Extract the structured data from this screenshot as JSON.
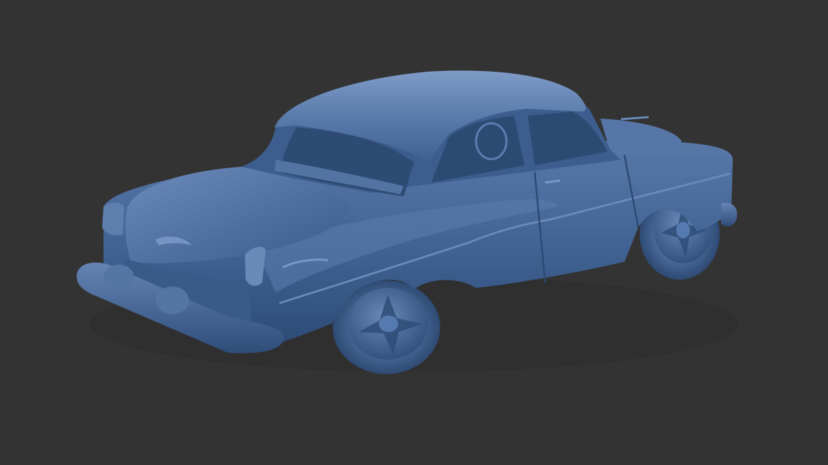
{
  "viewport": {
    "background": "#333333"
  },
  "model": {
    "subject": "car-model-render",
    "body_color": "#3d5f8f",
    "highlight_color": "#6f8fbe",
    "shadow_color": "#243d60",
    "interior_color": "#2e4b74"
  }
}
